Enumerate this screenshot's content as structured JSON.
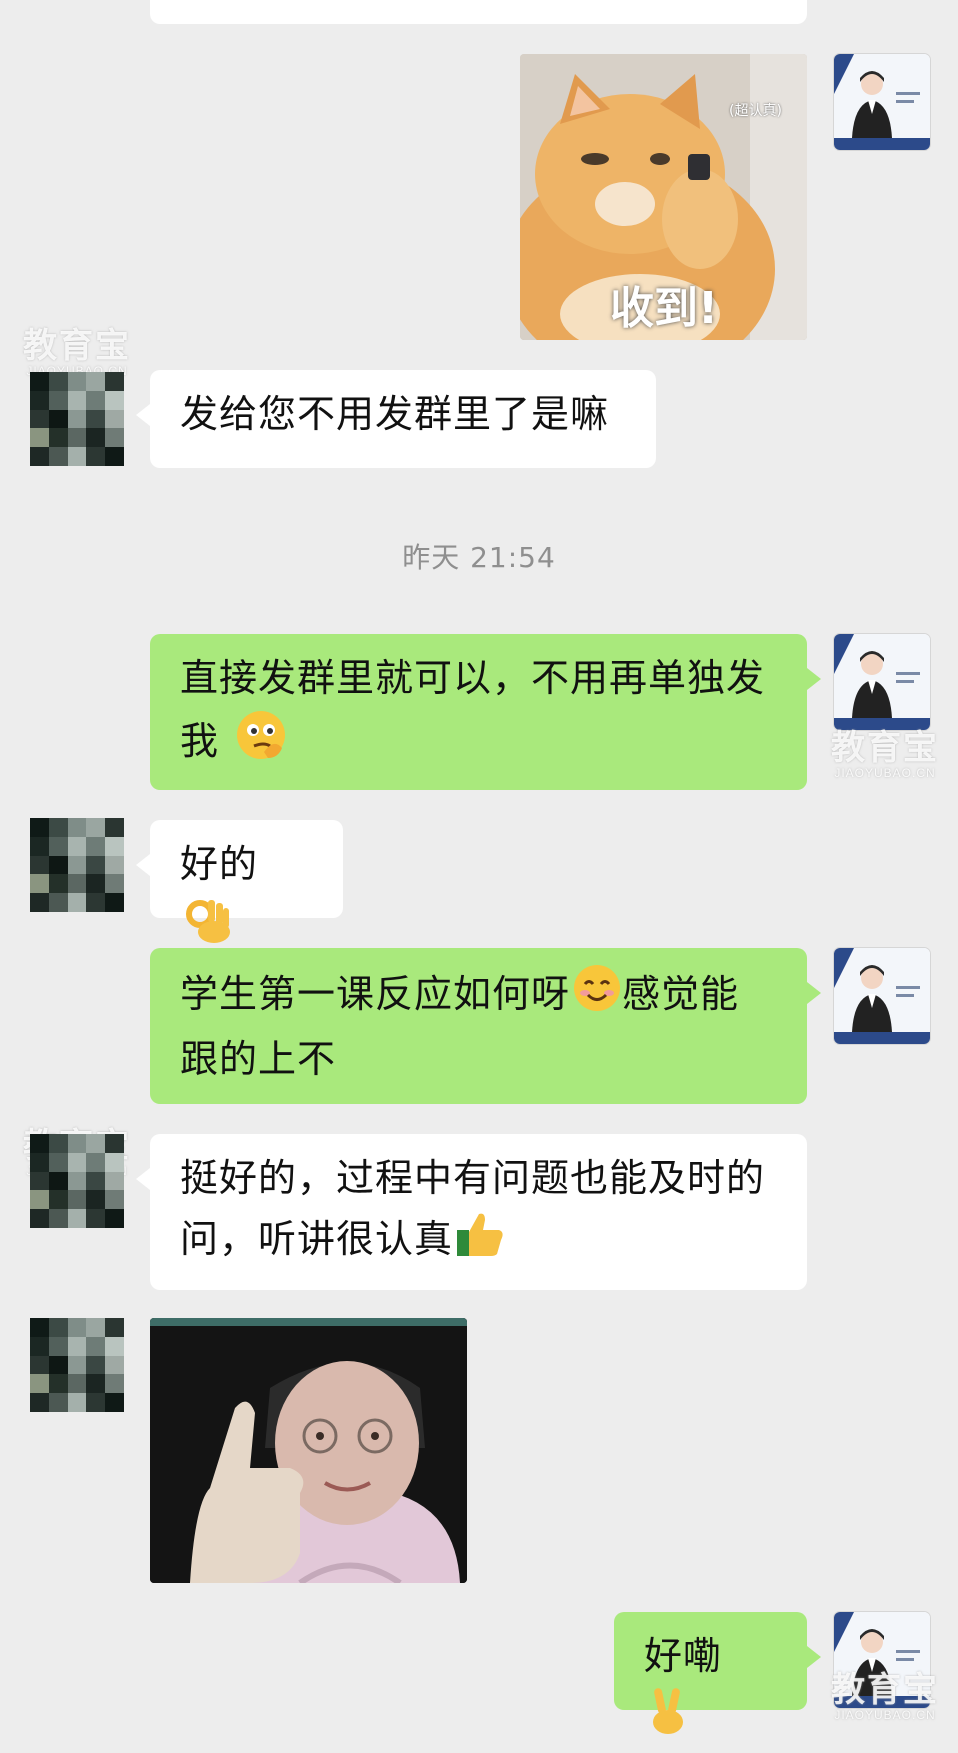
{
  "chat": {
    "timestamp": "昨天 21:54",
    "messages": [
      {
        "sender": "self",
        "type": "image",
        "image": "cat-sticker",
        "caption": "收到!",
        "tag": "(超认真)"
      },
      {
        "sender": "other",
        "type": "text",
        "text": "发给您不用发群里了是嘛"
      },
      {
        "sender": "self",
        "type": "text",
        "text": "直接发群里就可以，不用再单独发我",
        "emoji": "thinking-face-emoji"
      },
      {
        "sender": "other",
        "type": "text",
        "text": "好的",
        "emoji": "ok-hand-emoji"
      },
      {
        "sender": "self",
        "type": "text",
        "text": "学生第一课反应如何呀😊感觉能跟的上不",
        "line1": "学生第一课反应如何呀",
        "line1b": "感觉能",
        "line2": "跟的上不",
        "emoji": "smiling-face-emoji"
      },
      {
        "sender": "other",
        "type": "text",
        "text": "挺好的，过程中有问题也能及时的问，听讲很认真",
        "line1": "挺好的，过程中有问题也能及时的",
        "line2": "问，听讲很认真",
        "emoji": "thumbs-up-emoji"
      },
      {
        "sender": "other",
        "type": "image",
        "image": "thumbs-up-photo"
      },
      {
        "sender": "self",
        "type": "text",
        "text": "好嘞",
        "emoji": "victory-hand-emoji"
      }
    ]
  },
  "watermark": {
    "big": "教育宝",
    "small": "JIAOYUBAO.CN"
  },
  "colors": {
    "background": "#ededed",
    "incoming": "#ffffff",
    "outgoing": "#a9e97c",
    "timestamp": "#8f8f8f"
  }
}
